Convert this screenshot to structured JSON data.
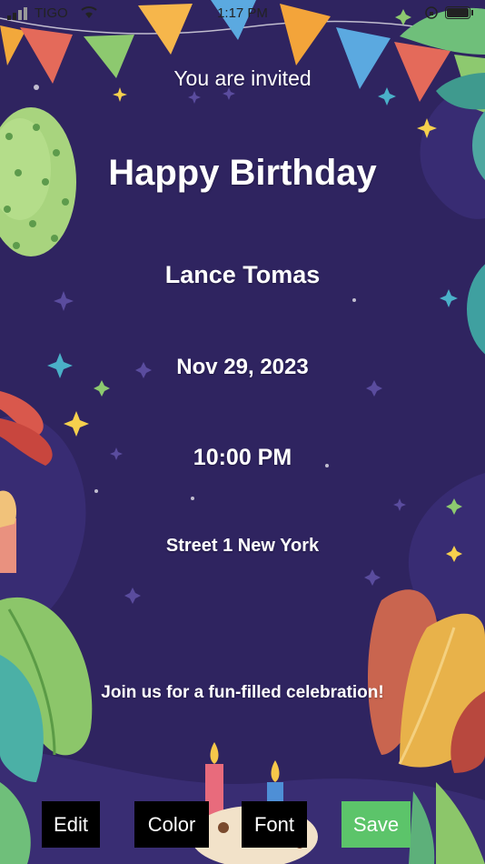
{
  "status_bar": {
    "carrier": "TIGO",
    "time": "1:17 PM"
  },
  "invitation": {
    "intro": "You are invited",
    "title": "Happy Birthday",
    "name": "Lance Tomas",
    "date": "Nov 29, 2023",
    "time": "10:00 PM",
    "address": "Street 1 New York",
    "message": "Join us for a fun-filled celebration!"
  },
  "toolbar": {
    "edit_label": "Edit",
    "color_label": "Color",
    "font_label": "Font",
    "save_label": "Save"
  },
  "colors": {
    "background": "#2f2460",
    "text": "#ffffff",
    "button_bg": "#000000",
    "save_bg": "#5cc46a"
  }
}
